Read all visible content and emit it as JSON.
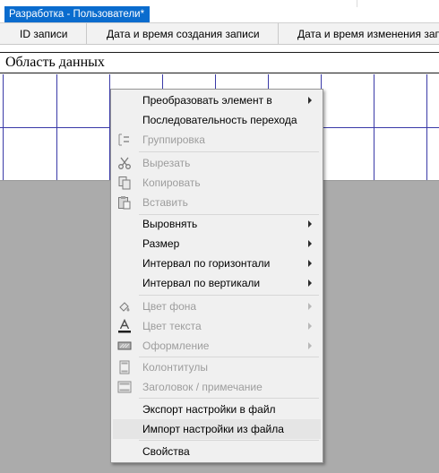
{
  "tab": {
    "title": "Разработка - Пользователи*"
  },
  "columns": [
    {
      "label": "ID записи"
    },
    {
      "label": "Дата и время создания записи"
    },
    {
      "label": "Дата и время изменения записи"
    }
  ],
  "section": {
    "title": "Область данных"
  },
  "menu": {
    "items": [
      {
        "label": "Преобразовать элемент в",
        "submenu": true,
        "enabled": true
      },
      {
        "label": "Последовательность перехода",
        "enabled": true
      },
      {
        "label": "Группировка",
        "icon": "grouping-icon",
        "enabled": false
      },
      {
        "label": "Вырезать",
        "icon": "scissors-icon",
        "enabled": false
      },
      {
        "label": "Копировать",
        "icon": "copy-icon",
        "enabled": false
      },
      {
        "label": "Вставить",
        "icon": "paste-icon",
        "enabled": false
      },
      {
        "label": "Выровнять",
        "submenu": true,
        "enabled": true
      },
      {
        "label": "Размер",
        "submenu": true,
        "enabled": true
      },
      {
        "label": "Интервал по горизонтали",
        "submenu": true,
        "enabled": true
      },
      {
        "label": "Интервал по вертикали",
        "submenu": true,
        "enabled": true
      },
      {
        "label": "Цвет фона",
        "icon": "fill-color-icon",
        "submenu": true,
        "enabled": false
      },
      {
        "label": "Цвет текста",
        "icon": "text-color-icon",
        "submenu": true,
        "enabled": false
      },
      {
        "label": "Оформление",
        "icon": "effect-icon",
        "submenu": true,
        "enabled": false
      },
      {
        "label": "Колонтитулы",
        "icon": "page-header-icon",
        "enabled": false
      },
      {
        "label": "Заголовок / примечание",
        "icon": "form-header-icon",
        "enabled": false
      },
      {
        "label": "Экспорт настройки в файл",
        "enabled": true
      },
      {
        "label": "Импорт настройки из файла",
        "enabled": true,
        "highlighted": true
      },
      {
        "label": "Свойства",
        "enabled": true
      }
    ]
  },
  "colors": {
    "tab": "#0a6cce",
    "grid_lines": "#3a3aa8",
    "menu_bg": "#f0f0f0",
    "disabled_text": "#9d9d9d"
  }
}
